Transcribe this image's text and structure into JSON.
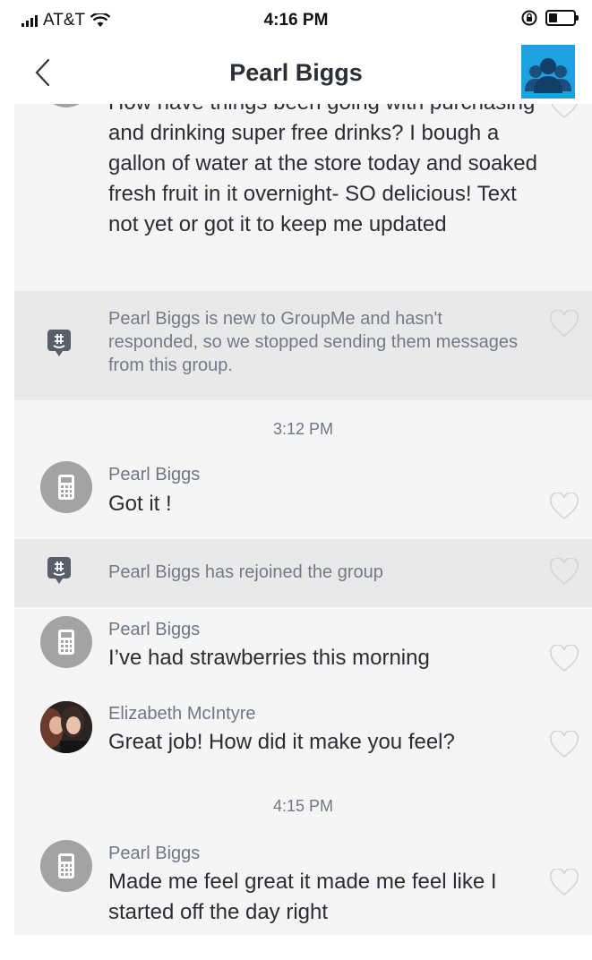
{
  "status_bar": {
    "carrier": "AT&T",
    "time": "4:16 PM"
  },
  "header": {
    "title": "Pearl Biggs"
  },
  "messages": [
    {
      "text": "How have things been going with purchasing and drinking super free drinks? I bough a gallon of water at the store today and soaked fresh fruit in it overnight- SO delicious! Text not yet or got it to keep me updated"
    },
    {
      "system_text": "Pearl Biggs is new to GroupMe and hasn't responded, so we stopped sending them messages from this group."
    },
    {
      "timestamp": "3:12 PM"
    },
    {
      "sender": "Pearl Biggs",
      "text": "Got it !"
    },
    {
      "system_text": "Pearl Biggs has rejoined the group"
    },
    {
      "sender": "Pearl Biggs",
      "text": "I’ve had strawberries this morning"
    },
    {
      "sender": "Elizabeth McIntyre",
      "text": "Great job! How did it make you feel?"
    },
    {
      "timestamp": "4:15 PM"
    },
    {
      "sender": "Pearl Biggs",
      "text": "Made me feel great it made me feel like I started off the day right"
    }
  ],
  "colors": {
    "group_avatar": "#1ea1e0",
    "system_band": "#e9e9ea",
    "feed_bg": "#f5f5f5",
    "sms_avatar": "#a3a3a4"
  }
}
